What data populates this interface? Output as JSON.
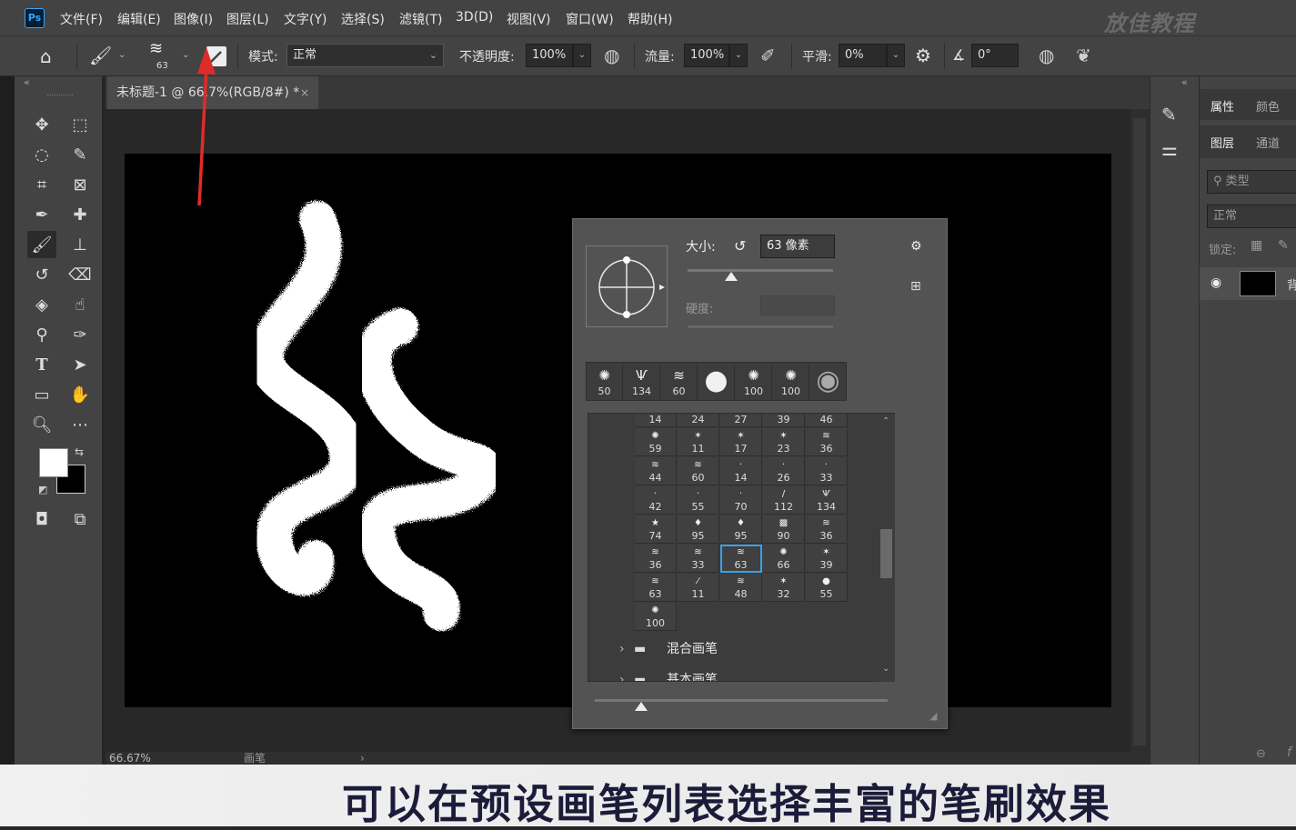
{
  "app": {
    "logo": "Ps",
    "watermark": "放佳教程"
  },
  "menubar": {
    "items": [
      "文件(F)",
      "编辑(E)",
      "图像(I)",
      "图层(L)",
      "文字(Y)",
      "选择(S)",
      "滤镜(T)",
      "3D(D)",
      "视图(V)",
      "窗口(W)",
      "帮助(H)"
    ]
  },
  "options": {
    "brush_size": "63",
    "mode_label": "模式:",
    "mode_value": "正常",
    "opacity_label": "不透明度:",
    "opacity_value": "100%",
    "flow_label": "流量:",
    "flow_value": "100%",
    "smooth_label": "平滑:",
    "smooth_value": "0%",
    "angle_value": "0°"
  },
  "document": {
    "tab_title": "未标题-1 @ 66.7%(RGB/8#) *",
    "zoom": "66.67%",
    "status_label": "画笔"
  },
  "brush_panel": {
    "size_label": "大小:",
    "size_value": "63 像素",
    "hardness_label": "硬度:",
    "recent": [
      {
        "g": "✺",
        "n": "50"
      },
      {
        "g": "Ѱ",
        "n": "134"
      },
      {
        "g": "≋",
        "n": "60"
      },
      {
        "g": "●",
        "n": ""
      },
      {
        "g": "✺",
        "n": "100"
      },
      {
        "g": "✺",
        "n": "100"
      },
      {
        "g": "◉",
        "n": ""
      }
    ],
    "grid": [
      [
        {
          "g": "",
          "n": "14"
        },
        {
          "g": "",
          "n": "24"
        },
        {
          "g": "",
          "n": "27"
        },
        {
          "g": "",
          "n": "39"
        },
        {
          "g": "",
          "n": "46"
        }
      ],
      [
        {
          "g": "✺",
          "n": "59"
        },
        {
          "g": "✶",
          "n": "11"
        },
        {
          "g": "✶",
          "n": "17"
        },
        {
          "g": "✶",
          "n": "23"
        },
        {
          "g": "≋",
          "n": "36"
        }
      ],
      [
        {
          "g": "≋",
          "n": "44"
        },
        {
          "g": "≋",
          "n": "60"
        },
        {
          "g": "·",
          "n": "14"
        },
        {
          "g": "·",
          "n": "26"
        },
        {
          "g": "·",
          "n": "33"
        }
      ],
      [
        {
          "g": "·",
          "n": "42"
        },
        {
          "g": "·",
          "n": "55"
        },
        {
          "g": "·",
          "n": "70"
        },
        {
          "g": "/",
          "n": "112"
        },
        {
          "g": "Ѱ",
          "n": "134"
        }
      ],
      [
        {
          "g": "★",
          "n": "74"
        },
        {
          "g": "♦",
          "n": "95"
        },
        {
          "g": "♦",
          "n": "95"
        },
        {
          "g": "▩",
          "n": "90"
        },
        {
          "g": "≋",
          "n": "36"
        }
      ],
      [
        {
          "g": "≋",
          "n": "36"
        },
        {
          "g": "≋",
          "n": "33"
        },
        {
          "g": "≋",
          "n": "63"
        },
        {
          "g": "✺",
          "n": "66"
        },
        {
          "g": "✶",
          "n": "39"
        }
      ],
      [
        {
          "g": "≋",
          "n": "63"
        },
        {
          "g": "⁄",
          "n": "11"
        },
        {
          "g": "≋",
          "n": "48"
        },
        {
          "g": "✶",
          "n": "32"
        },
        {
          "g": "●",
          "n": "55"
        }
      ],
      [
        {
          "g": "✺",
          "n": "100"
        }
      ]
    ],
    "folders": [
      "混合画笔",
      "基本画笔"
    ]
  },
  "right_panel": {
    "tab_properties": "属性",
    "tab_color": "颜色",
    "tab_layers": "图层",
    "tab_channels": "通道",
    "search_placeholder": "类型",
    "blend_mode": "正常",
    "lock_label": "锁定:",
    "layer_name": "背"
  },
  "caption": {
    "text": "可以在预设画笔列表选择丰富的笔刷效果"
  },
  "colors": {
    "accent": "#3ba0e6",
    "annotation_arrow": "#e02b2b",
    "caption_text": "#1c1c3a"
  }
}
